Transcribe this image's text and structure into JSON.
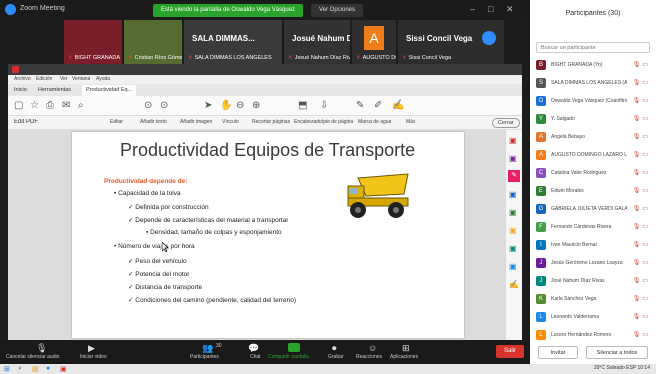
{
  "app": {
    "name": "Zoom Meeting",
    "share_banner": "Está viendo la pantalla de Oswaldo Vega Vásquez",
    "view_options": "Ver Opciones",
    "window_controls": [
      "–",
      "□",
      "✕"
    ]
  },
  "video_tiles": [
    {
      "name": "BIGHT GRANADA",
      "color": "#7a1e2a",
      "big": ""
    },
    {
      "name": "Cristian Ríos Gómez Luis",
      "color": "#556b2f",
      "big": ""
    },
    {
      "name": "SALA DIMMAS LOS ANGELES",
      "color": "#3a3a3a",
      "big": "SALA DIMMAS..."
    },
    {
      "name": "Josué Nahum Díaz Rivas",
      "color": "#333",
      "big": "Josué Nahum D..."
    },
    {
      "name": "AUGUSTO DOMINGO L.",
      "color": "#2f2f2f",
      "big": "A",
      "accent": "#f07d1a"
    },
    {
      "name": "Sissi Concil Vega",
      "color": "#2d2d2d",
      "big": "Sissi Concil Vega"
    }
  ],
  "acrobat": {
    "menu": [
      "Archivo",
      "Edición",
      "Ver",
      "Ventana",
      "Ayuda"
    ],
    "tabs": [
      "Inicio",
      "Herramientas",
      "Productividad Eq..."
    ],
    "edit_label": "Edit PDF",
    "edit_tools": [
      "Editar",
      "Añadir texto",
      "Añadir imagen",
      "Vínculo",
      "Recortar páginas",
      "Encabezado/pie de página",
      "Marca de agua",
      "Más"
    ],
    "close_label": "Cerrar"
  },
  "slide": {
    "title": "Productividad Equipos de Transporte",
    "lines": [
      {
        "text": "Productividad depende de:",
        "level": 0,
        "style": "red"
      },
      {
        "text": "• Capacidad de la tolva",
        "level": 1
      },
      {
        "text": "✓ Definida por construcción",
        "level": 2
      },
      {
        "text": "✓ Depende de características del material a transportar",
        "level": 2
      },
      {
        "text": "▪ Densidad, tamaño de colpas y esponjamiento",
        "level": 3
      },
      {
        "text": "• Número de viajes por hora",
        "level": 1
      },
      {
        "text": "✓ Peso del vehículo",
        "level": 2
      },
      {
        "text": "✓ Potencia del motor",
        "level": 2
      },
      {
        "text": "✓ Distancia de transporte",
        "level": 2
      },
      {
        "text": "✓ Condiciones del camino (pendiente, calidad del terreno)",
        "level": 2
      }
    ]
  },
  "zoom_toolbar": {
    "left": [
      {
        "label": "Cancelar silenciar audio",
        "icon": "mic-icon"
      },
      {
        "label": "Iniciar video",
        "icon": "video-icon"
      }
    ],
    "center": [
      {
        "label": "Participantes",
        "icon": "people-icon",
        "count": "30"
      },
      {
        "label": "Chat",
        "icon": "chat-icon"
      },
      {
        "label": "Compartir pantalla",
        "icon": "share-icon"
      },
      {
        "label": "Grabar",
        "icon": "record-icon"
      },
      {
        "label": "Reacciones",
        "icon": "reaction-icon"
      },
      {
        "label": "Aplicaciones",
        "icon": "apps-icon"
      }
    ],
    "leave": "Salir"
  },
  "panel": {
    "title": "Participantes (30)",
    "search_placeholder": "Buscar un participante",
    "participants": [
      {
        "name": "BIGHT GRANADA (Yo)",
        "color": "#7a1e2a",
        "initial": "B"
      },
      {
        "name": "SALA DIMMAS LOS ANGELES (Anfitrión)",
        "color": "#555",
        "initial": "S"
      },
      {
        "name": "Oswaldo Vega Vásquez (Coanfitrión)",
        "color": "#1a6fd1",
        "initial": "O"
      },
      {
        "name": "Y. Salgado",
        "color": "#2a8a3a",
        "initial": "Y"
      },
      {
        "name": "Angela Bebayo",
        "color": "#e0742c",
        "initial": "A"
      },
      {
        "name": "AUGUSTO DOMINGO LAZARO L.",
        "color": "#f07d1a",
        "initial": "A"
      },
      {
        "name": "Catalina Valer Rodríguez",
        "color": "#8a4fbf",
        "initial": "C"
      },
      {
        "name": "Edwin Morales",
        "color": "#2e7d32",
        "initial": "E"
      },
      {
        "name": "GABRIELA JULIETA VERDI GALAN",
        "color": "#1565c0",
        "initial": "G"
      },
      {
        "name": "Fernando Cárdenas Rivera",
        "color": "#43a047",
        "initial": "F"
      },
      {
        "name": "Ivan Mauricio Bernal",
        "color": "#0277bd",
        "initial": "I"
      },
      {
        "name": "Jesús Gerónimo Lozano Loayza",
        "color": "#6a1b9a",
        "initial": "J"
      },
      {
        "name": "José Nahum Díaz Rivas",
        "color": "#00897b",
        "initial": "J"
      },
      {
        "name": "Karla Sánchez Vega",
        "color": "#558b2f",
        "initial": "K"
      },
      {
        "name": "Leonardo Valderrama",
        "color": "#1e88e5",
        "initial": "L"
      },
      {
        "name": "Lucero Hernández Romero",
        "color": "#fb8c00",
        "initial": "L"
      }
    ],
    "invite": "Invitar",
    "mute_all": "Silenciar a todos"
  },
  "taskbar": {
    "status": "20°C Soleado",
    "lang": "ESP",
    "time": "10:14"
  }
}
